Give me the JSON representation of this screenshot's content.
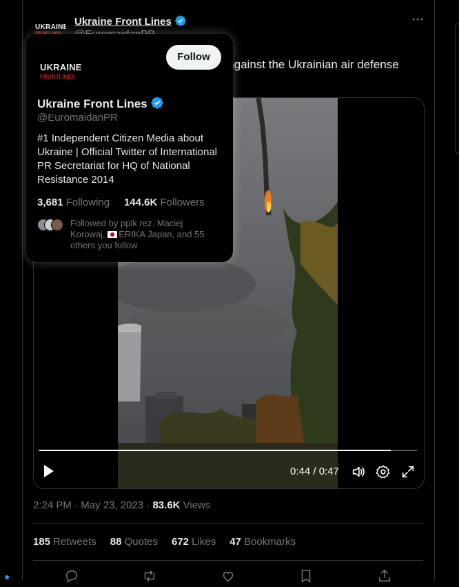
{
  "post": {
    "author_name": "Ukraine Front Lines",
    "author_handle": "@EuromaidanPR",
    "avatar_line1": "UKRAINE",
    "avatar_line2": "FRONTLINES",
    "text_visible": "e against the Ukrainian air defense",
    "more_icon": "more-horizontal-icon"
  },
  "video": {
    "time": "0:44 / 0:47",
    "progress_fraction": 0.93,
    "controls": [
      "play-icon",
      "volume-icon",
      "settings-icon",
      "fullscreen-icon"
    ]
  },
  "meta": {
    "time": "2:24 PM",
    "date": "May 23, 2023",
    "views_count": "83.6K",
    "views_label": "Views"
  },
  "stats": [
    {
      "count": "185",
      "label": "Retweets"
    },
    {
      "count": "88",
      "label": "Quotes"
    },
    {
      "count": "672",
      "label": "Likes"
    },
    {
      "count": "47",
      "label": "Bookmarks"
    }
  ],
  "actions": [
    "reply-icon",
    "retweet-icon",
    "like-icon",
    "bookmark-icon",
    "share-icon"
  ],
  "hover_card": {
    "name": "Ukraine Front Lines",
    "handle": "@EuromaidanPR",
    "follow_label": "Follow",
    "bio": "#1 Independent Citizen Media about Ukraine | Official Twitter of International PR Secretariat for HQ of National Resistance 2014",
    "following_count": "3,681",
    "following_label": "Following",
    "followers_count": "144.6K",
    "followers_label": "Followers",
    "followed_by_prefix": "Followed by pplk rez. Maciej Korowaj,",
    "followed_by_flag_name": "ERIKA Japan",
    "followed_by_suffix": ", and 55 others you follow"
  },
  "colors": {
    "background": "#000000",
    "text": "#e7e9ea",
    "secondary": "#71767b",
    "border": "#2f3336",
    "verified": "#1d9bf0",
    "follow_button": "#eff3f4"
  }
}
